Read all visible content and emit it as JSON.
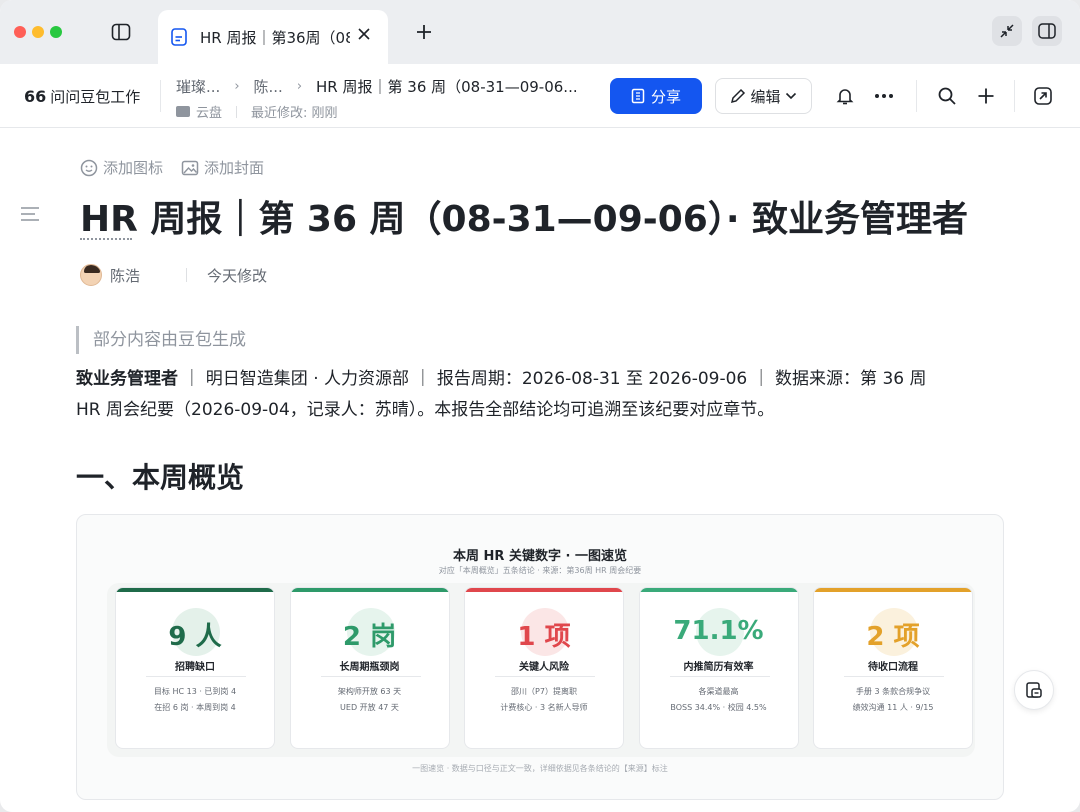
{
  "tab": {
    "title": "HR 周报｜第36周（08"
  },
  "toolbar": {
    "workspace_icon": "66",
    "workspace_label": "问问豆包工作",
    "crumbs": [
      "璀璨...",
      "陈...",
      "HR 周报｜第 36 周（08-31—09-06..."
    ],
    "location": "云盘",
    "last_modified": "最近修改: 刚刚",
    "share_label": "分享",
    "edit_label": "编辑"
  },
  "doc": {
    "add_icon_label": "添加图标",
    "add_cover_label": "添加封面",
    "title": "HR 周报｜第 36 周（08-31—09-06）· 致业务管理者",
    "author": "陈浩",
    "modified": "今天修改",
    "ai_notice": "部分内容由豆包生成",
    "intro_bold": "致业务管理者",
    "intro_line1": "｜ 明日智造集团 · 人力资源部 ｜ 报告周期：2026-08-31 至 2026-09-06 ｜ 数据来源：第 36 周",
    "intro_line2": "HR 周会纪要（2026-09-04，记录人：苏晴）。本报告全部结论均可追溯至该纪要对应章节。",
    "section1_heading": "一、本周概览"
  },
  "figure": {
    "title": "本周 HR 关键数字 · 一图速览",
    "subtitle": "对应「本周概览」五条结论 · 来源：第36周 HR 周会纪要",
    "footer": "一图速览 · 数据与口径与正文一致，详细依据见各条结论的【来源】标注",
    "cards": [
      {
        "value": "9 人",
        "label": "招聘缺口",
        "line1": "目标 HC 13 · 已到岗 4",
        "line2": "在招 6 岗 · 本周到岗 4",
        "color": "#1f6b4a",
        "tint": "#e4f1ea"
      },
      {
        "value": "2 岗",
        "label": "长周期瓶颈岗",
        "line1": "架构师开放 63 天",
        "line2": "UED 开放 47 天",
        "color": "#2e9a6a",
        "tint": "#e6f4ed"
      },
      {
        "value": "1 项",
        "label": "关键人风险",
        "line1": "邵川（P7）提离职",
        "line2": "计费核心 · 3 名新人导师",
        "color": "#e0474c",
        "tint": "#fbe6e6"
      },
      {
        "value": "71.1%",
        "label": "内推简历有效率",
        "line1": "各渠道最高",
        "line2": "BOSS 34.4% · 校园 4.5%",
        "color": "#3aaa7a",
        "tint": "#e6f4ed"
      },
      {
        "value": "2 项",
        "label": "待收口流程",
        "line1": "手册 3 条款合规争议",
        "line2": "绩效沟通 11 人 · 9/15",
        "color": "#e3a12a",
        "tint": "#fbf1dd"
      }
    ]
  }
}
